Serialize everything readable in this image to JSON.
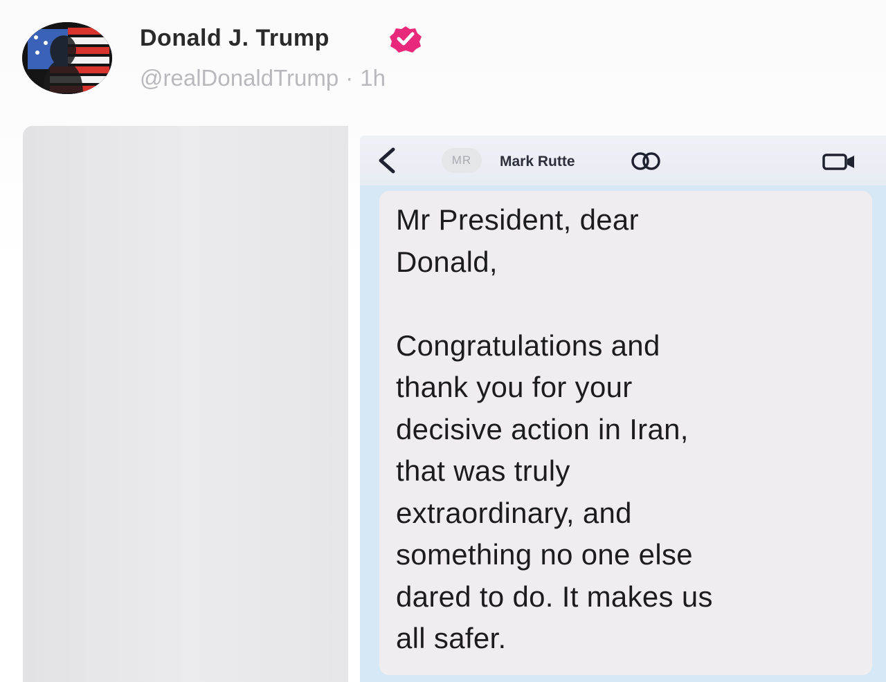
{
  "post": {
    "author": {
      "display_name": "Donald J. Trump",
      "handle": "@realDonaldTrump",
      "separator": "·",
      "time": "1h",
      "verified": true,
      "badge_color": "#e8287a"
    }
  },
  "screenshot": {
    "chat_header": {
      "back_icon": "chevron-left-icon",
      "contact_initials": "MR",
      "contact_name": "Mark Rutte",
      "group_icon": "linked-circles-icon",
      "video_icon": "video-camera-icon"
    },
    "message": {
      "text": "Mr President, dear\nDonald,\n\nCongratulations and\nthank you for your\ndecisive action in Iran,\nthat was truly\nextraordinary, and\nsomething no one else\ndared to do.  It makes us\nall safer."
    },
    "colors": {
      "chat_background": "#d6e8f5",
      "bubble": "#efedef"
    }
  }
}
